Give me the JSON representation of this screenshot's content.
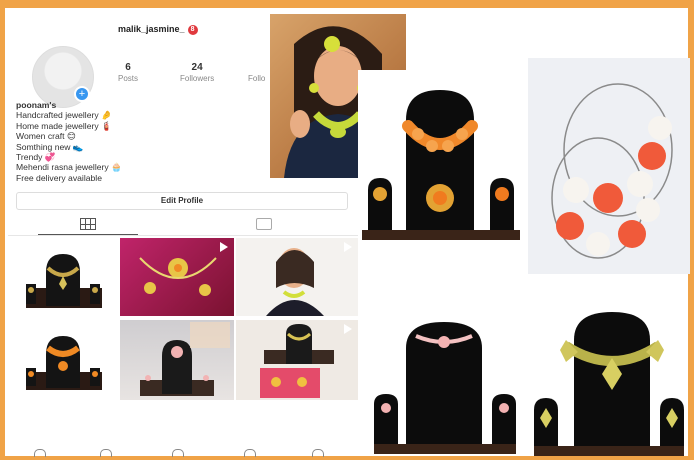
{
  "profile": {
    "username": "malik_jasmine_",
    "notification_count": "8",
    "stats": [
      {
        "value": "6",
        "label": "Posts"
      },
      {
        "value": "24",
        "label": "Followers"
      },
      {
        "value": "",
        "label": "Follo"
      }
    ],
    "bio_name": "poonam's",
    "bio_lines": [
      "Handcrafted jewellery 🤌",
      "Home made jewellery 🧯",
      "Women craft 😊",
      "Somthing new 👟",
      "Trendy 💞",
      "Mehendi rasna jewellery 🧁",
      "Free delivery available"
    ],
    "edit_button": "Edit Profile",
    "tabs": [
      "grid-icon",
      "tagged-icon"
    ],
    "nav_icons": [
      "home-icon",
      "search-icon",
      "add-icon",
      "activity-icon",
      "profile-icon"
    ]
  },
  "colors": {
    "frame": "#f0a347",
    "accent": "#3897f0",
    "badge": "#e0393e"
  }
}
